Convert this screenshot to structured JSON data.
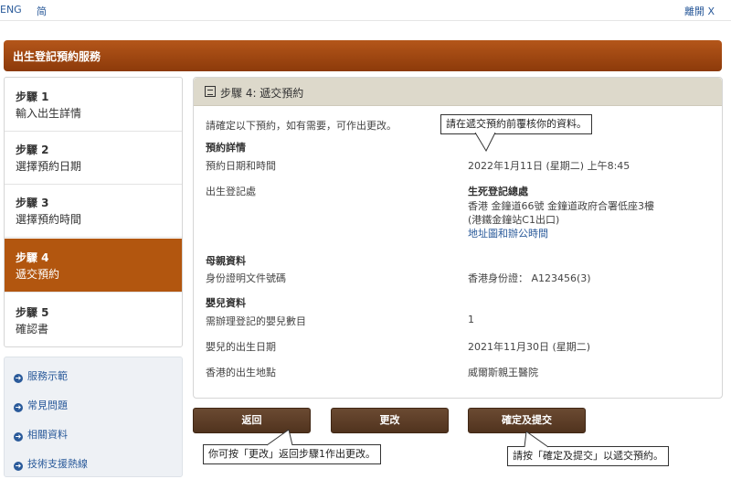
{
  "topbar": {
    "lang_en": "ENG",
    "lang_simplified": "简",
    "close": "離開 X"
  },
  "banner": {
    "title": "出生登記預約服務"
  },
  "steps": [
    {
      "num": "步驟 1",
      "label": "輸入出生詳情"
    },
    {
      "num": "步驟 2",
      "label": "選擇預約日期"
    },
    {
      "num": "步驟 3",
      "label": "選擇預約時間"
    },
    {
      "num": "步驟 4",
      "label": "遞交預約"
    },
    {
      "num": "步驟 5",
      "label": "確認書"
    }
  ],
  "side_links": [
    "服務示範",
    "常見問題",
    "相關資料",
    "技術支援熱線"
  ],
  "panel": {
    "title": "步驟 4: 遞交預約",
    "intro": "請確定以下預約，如有需要，可作出更改。",
    "booking_heading": "預約詳情",
    "appt_label": "預約日期和時間",
    "appt_value": "2022年1月11日 (星期二) 上午8:45",
    "office_label": "出生登記處",
    "office_name": "生死登記總處",
    "office_addr1": "香港 金鐘道66號 金鐘道政府合署低座3樓",
    "office_addr2": "(港鐵金鐘站C1出口)",
    "office_link": "地址圖和辦公時間",
    "mother_heading": "母親資料",
    "id_label": "身份證明文件號碼",
    "id_value": "香港身份證：  A123456(3)",
    "baby_heading": "嬰兒資料",
    "count_label": "需辦理登記的嬰兒數目",
    "count_value": "1",
    "dob_label": "嬰兒的出生日期",
    "dob_value": "2021年11月30日 (星期二)",
    "place_label": "香港的出生地點",
    "place_value": "威爾斯親王醫院"
  },
  "buttons": {
    "back": "返回",
    "change": "更改",
    "submit": "確定及提交"
  },
  "callouts": {
    "review": "請在遞交預約前覆核你的資料。",
    "change": "你可按「更改」返回步驟1作出更改。",
    "submit": "請按「確定及提交」以遞交預約。"
  }
}
